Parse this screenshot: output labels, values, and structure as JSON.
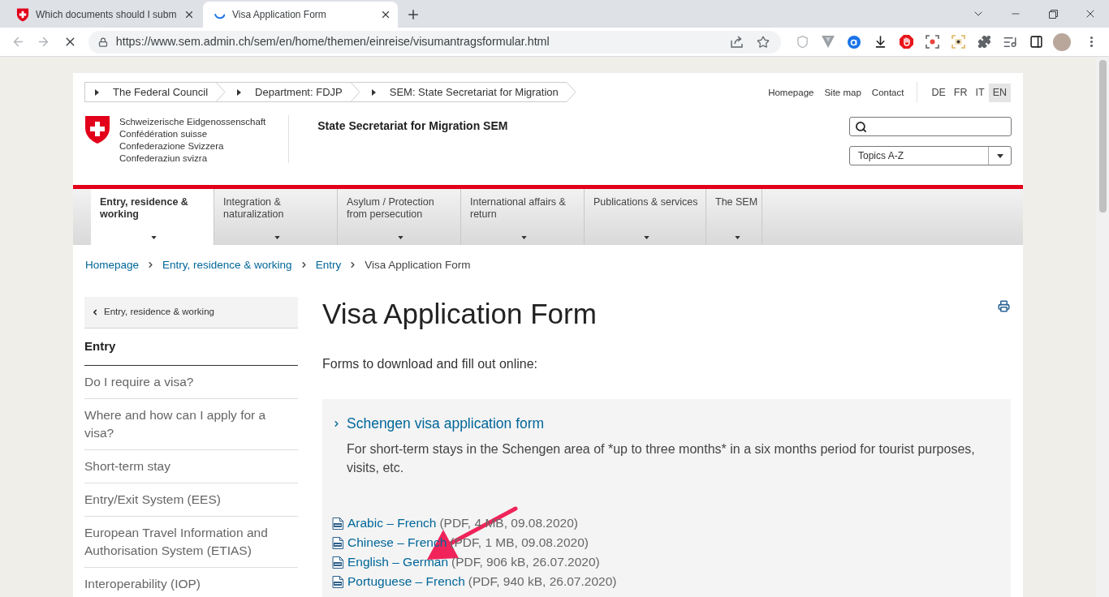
{
  "browser": {
    "tabs": [
      {
        "title": "Which documents should I subm",
        "selected": false,
        "loading": false
      },
      {
        "title": "Visa Application Form",
        "selected": true,
        "loading": true
      }
    ],
    "address_bar": {
      "url": "https://www.sem.admin.ch/sem/en/home/themen/einreise/visumantragsformular.html"
    }
  },
  "header": {
    "federal_breadcrumb": [
      "The Federal Council",
      "Department: FDJP",
      "SEM: State Secretariat for Migration"
    ],
    "service_links": [
      "Homepage",
      "Site map",
      "Contact"
    ],
    "languages": [
      {
        "label": "DE",
        "selected": false
      },
      {
        "label": "FR",
        "selected": false
      },
      {
        "label": "IT",
        "selected": false
      },
      {
        "label": "EN",
        "selected": true
      }
    ],
    "logo_lines": [
      "Schweizerische Eidgenossenschaft",
      "Confédération suisse",
      "Confederazione Svizzera",
      "Confederaziun svizra"
    ],
    "site_title": "State Secretariat for Migration SEM",
    "topics_select": {
      "value": "Topics A-Z"
    }
  },
  "main_nav": [
    {
      "label": "Entry, residence & working",
      "selected": true
    },
    {
      "label": "Integration & naturalization",
      "selected": false
    },
    {
      "label": "Asylum / Protection from persecution",
      "selected": false
    },
    {
      "label": "International affairs & return",
      "selected": false
    },
    {
      "label": "Publications & services",
      "selected": false
    },
    {
      "label": "The SEM",
      "selected": false
    }
  ],
  "breadcrumb": [
    "Homepage",
    "Entry, residence & working",
    "Entry",
    "Visa Application Form"
  ],
  "sidebar": {
    "back_link": "Entry, residence & working",
    "section_title": "Entry",
    "items": [
      "Do I require a visa?",
      "Where and how can I apply for a visa?",
      "Short-term stay",
      "Entry/Exit System (EES)",
      "European Travel Information and Authorisation System (ETIAS)",
      "Interoperability (IOP)"
    ]
  },
  "content": {
    "title": "Visa Application Form",
    "intro": "Forms to download and fill out online:",
    "form_box": {
      "heading": "Schengen visa application form",
      "description": "For short-term stays in the Schengen area of *up to three months* in a six months period for tourist purposes, visits, etc.",
      "downloads": [
        {
          "label": "Arabic – French",
          "info": "(PDF, 4 MB, 09.08.2020)"
        },
        {
          "label": "Chinese – French",
          "info": "(PDF, 1 MB, 09.08.2020)"
        },
        {
          "label": "English – German",
          "info": "(PDF, 906 kB, 26.07.2020)"
        },
        {
          "label": "Portuguese – French",
          "info": "(PDF, 940 kB, 26.07.2020)"
        }
      ]
    }
  }
}
